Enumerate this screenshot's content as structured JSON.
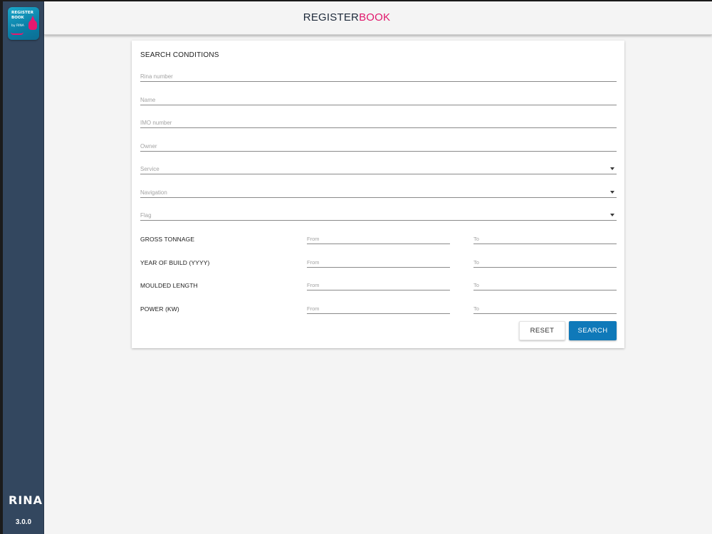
{
  "app": {
    "logo_line1": "REGISTER",
    "logo_line2": "BOOK",
    "logo_line3": "by RINA",
    "title_part1": "REGISTER",
    "title_part2": "BOOK",
    "brand": "RINA",
    "version": "3.0.0"
  },
  "colors": {
    "sidebar": "#33475f",
    "accent_pink": "#e0176b",
    "primary_button": "#0f79b9"
  },
  "search": {
    "title": "SEARCH CONDITIONS",
    "fields": [
      {
        "placeholder": "Rina number",
        "type": "text"
      },
      {
        "placeholder": "Name",
        "type": "text"
      },
      {
        "placeholder": "IMO number",
        "type": "text"
      },
      {
        "placeholder": "Owner",
        "type": "text"
      },
      {
        "placeholder": "Service",
        "type": "select"
      },
      {
        "placeholder": "Navigation",
        "type": "select"
      },
      {
        "placeholder": "Flag",
        "type": "select"
      }
    ],
    "ranges": [
      {
        "label": "GROSS TONNAGE",
        "from": "From",
        "to": "To"
      },
      {
        "label": "YEAR OF BUILD (YYYY)",
        "from": "From",
        "to": "To"
      },
      {
        "label": "MOULDED LENGTH",
        "from": "From",
        "to": "To"
      },
      {
        "label": "POWER (KW)",
        "from": "From",
        "to": "To"
      }
    ],
    "reset_label": "RESET",
    "search_label": "SEARCH"
  },
  "icons": {
    "dropdown": "chevron-down-icon"
  }
}
